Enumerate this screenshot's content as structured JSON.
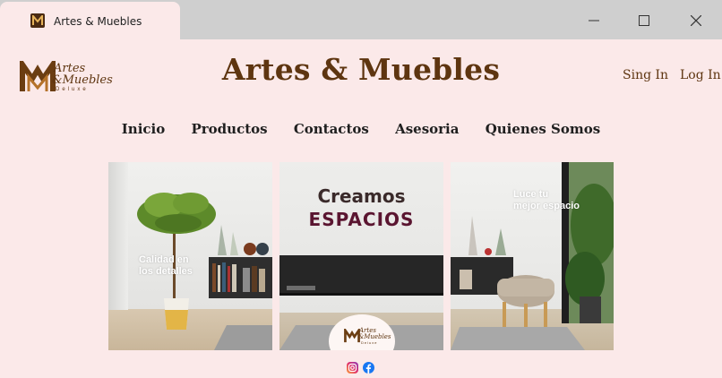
{
  "window": {
    "tab_title": "Artes & Muebles",
    "controls": [
      "minimize",
      "maximize",
      "close"
    ]
  },
  "header": {
    "logo": {
      "line1": "Artes",
      "line2": "&Muebles",
      "line3": "Deluxe"
    },
    "brand": "Artes & Muebles",
    "signin": "Sing In",
    "login": "Log In"
  },
  "nav": [
    "Inicio",
    "Productos",
    "Contactos",
    "Asesoria",
    "Quienes Somos"
  ],
  "gallery": {
    "panel1_text": [
      "Calidad en",
      "los detalles"
    ],
    "panel2_title1": "Creamos",
    "panel2_title2": "ESPACIOS",
    "panel2_badge": {
      "line1": "Artes",
      "line2": "&Muebles",
      "line3": "Deluxe"
    },
    "panel3_text": [
      "Luce tu",
      "mejor espacio"
    ]
  },
  "social": [
    "instagram-icon",
    "facebook-icon"
  ],
  "colors": {
    "brand": "#5e3510",
    "background": "#fbe9e9",
    "chrome": "#cfcfcf",
    "espacios": "#5a1530"
  }
}
